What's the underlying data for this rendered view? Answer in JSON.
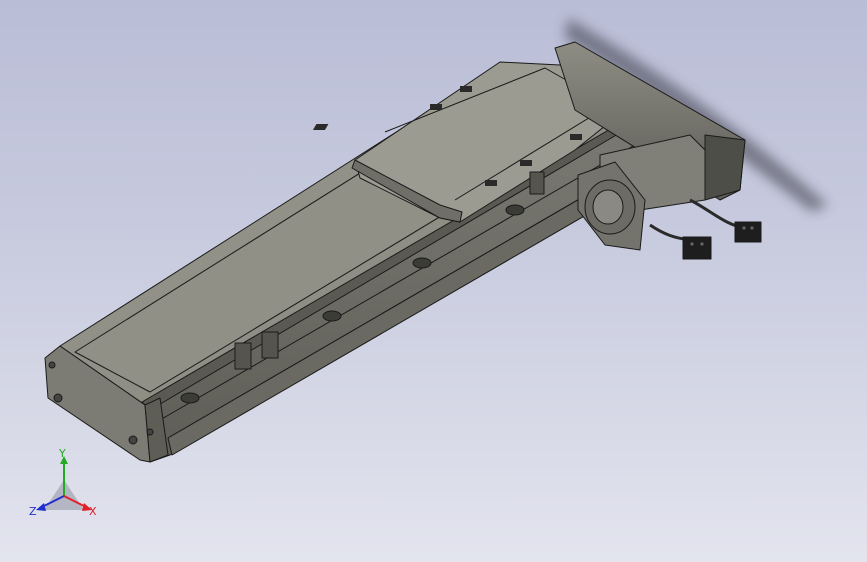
{
  "viewport": {
    "background_top": "#b9bdd6",
    "background_bottom": "#e3e4ee"
  },
  "model": {
    "body_color": "#8c8c82",
    "body_dark": "#5c5c54",
    "edge_color": "#1a1a1a",
    "rail_color": "#7d7d74"
  },
  "triad": {
    "x_label": "X",
    "y_label": "Y",
    "z_label": "Z",
    "x_color": "#e0202a",
    "y_color": "#22aa22",
    "z_color": "#2030d0"
  }
}
